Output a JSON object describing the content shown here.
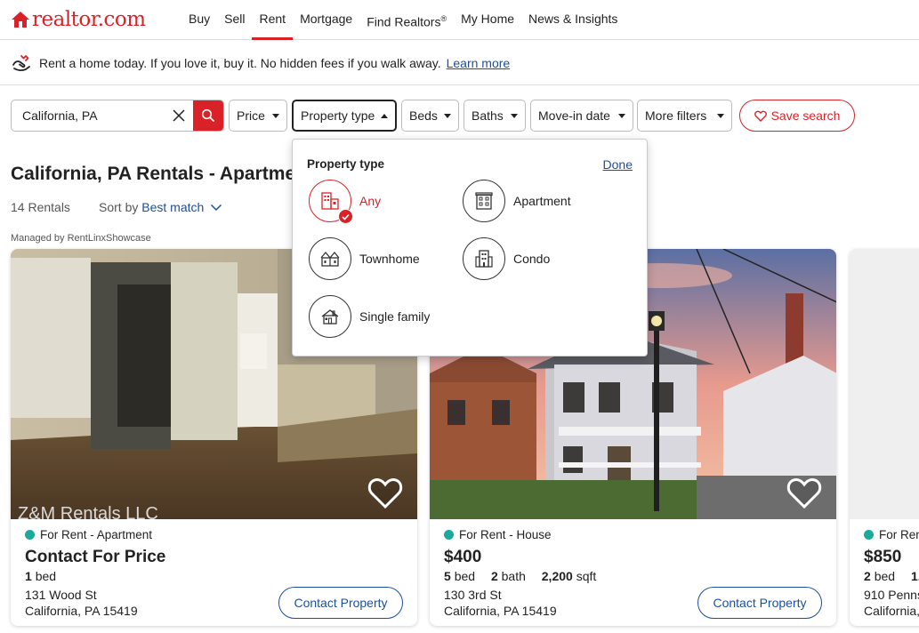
{
  "brand": {
    "name": "realtor.com",
    "color": "#d92228",
    "link_color": "#1b4f9c",
    "status_color": "#1aa99a"
  },
  "nav": {
    "items": [
      {
        "label": "Buy"
      },
      {
        "label": "Sell"
      },
      {
        "label": "Rent",
        "active": true
      },
      {
        "label": "Mortgage"
      },
      {
        "label": "Find Realtors",
        "sup": "®"
      },
      {
        "label": "My Home"
      },
      {
        "label": "News & Insights"
      }
    ]
  },
  "promo": {
    "icon": "handshake-icon",
    "text": "Rent a home today. If you love it, buy it. No hidden fees if you walk away.",
    "link": "Learn more"
  },
  "search": {
    "value": "California, PA",
    "clear_icon": "close-icon",
    "button_icon": "search-icon"
  },
  "filters": {
    "price": "Price",
    "property_type": "Property type",
    "beds": "Beds",
    "baths": "Baths",
    "move_in": "Move-in date",
    "more": "More filters",
    "save_search": "Save search"
  },
  "page": {
    "title": "California, PA Rentals - Apartme",
    "count": "14 Rentals",
    "sort_label": "Sort by",
    "sort_value": "Best match",
    "managed_by": "Managed by RentLinxShowcase"
  },
  "property_type_panel": {
    "title": "Property type",
    "done": "Done",
    "options": [
      {
        "label": "Any",
        "icon": "any-buildings-icon",
        "selected": true
      },
      {
        "label": "Apartment",
        "icon": "apartment-icon",
        "selected": false
      },
      {
        "label": "Townhome",
        "icon": "townhome-icon",
        "selected": false
      },
      {
        "label": "Condo",
        "icon": "condo-icon",
        "selected": false
      },
      {
        "label": "Single family",
        "icon": "single-family-icon",
        "selected": false
      }
    ]
  },
  "listings": [
    {
      "status": "For Rent - Apartment",
      "price": "Contact For Price",
      "specs": {
        "bed_value": "1",
        "bed_unit": "bed"
      },
      "address1": "131 Wood St",
      "address2": "California, PA 15419",
      "cta": "Contact Property",
      "image_watermark": "Z&M Rentals LLC"
    },
    {
      "status": "For Rent - House",
      "price": "$400",
      "specs": {
        "bed_value": "5",
        "bed_unit": "bed",
        "bath_value": "2",
        "bath_unit": "bath",
        "sqft_value": "2,200",
        "sqft_unit": "sqft"
      },
      "address1": "130 3rd St",
      "address2": "California, PA 15419",
      "cta": "Contact Property"
    },
    {
      "status": "For Rent",
      "price": "$850",
      "specs": {
        "bed_value": "2",
        "bed_unit": "bed",
        "bath_value": "1."
      },
      "address1": "910 Penns",
      "address2": "California,"
    }
  ]
}
